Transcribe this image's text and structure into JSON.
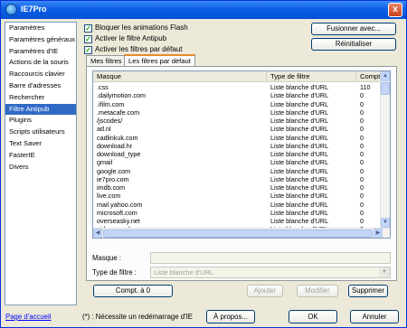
{
  "window": {
    "title": "IE7Pro",
    "close_glyph": "x"
  },
  "sidebar": {
    "items": [
      {
        "label": "Paramètres"
      },
      {
        "label": "Paramètres généraux"
      },
      {
        "label": "Paramètres d'IE"
      },
      {
        "label": "Actions de la souris"
      },
      {
        "label": "Raccourcis clavier"
      },
      {
        "label": "Barre d'adresses"
      },
      {
        "label": "Rechercher"
      },
      {
        "label": "Filtre Antipub",
        "selected": true
      },
      {
        "label": "Plugins"
      },
      {
        "label": "Scripts utilisateurs"
      },
      {
        "label": "Text Saver"
      },
      {
        "label": "FasterIE"
      },
      {
        "label": "Divers"
      }
    ]
  },
  "options": {
    "block_flash": "Bloquer les animations Flash",
    "enable_filter": "Activer le filtre Antipub",
    "enable_default": "Activer les filtres par défaut"
  },
  "buttons": {
    "merge": "Fusionner avec...",
    "reset": "Réinitialiser",
    "reset_count": "Compt. à 0",
    "add": "Ajouter",
    "modify": "Modifier",
    "delete": "Supprimer",
    "about": "À propos...",
    "ok": "OK",
    "cancel": "Annuler"
  },
  "tabs": [
    {
      "label": "Mes filtres"
    },
    {
      "label": "Les filtres par défaut",
      "active": true
    }
  ],
  "table": {
    "columns": [
      "Masque",
      "Type de filtre",
      "Compteu"
    ],
    "rows": [
      [
        ".css",
        "Liste blanche d'URL",
        "110"
      ],
      [
        ".dailymotion.com",
        "Liste blanche d'URL",
        "0"
      ],
      [
        ".ifilm.com",
        "Liste blanche d'URL",
        "0"
      ],
      [
        ".metacafe.com",
        "Liste blanche d'URL",
        "0"
      ],
      [
        "/jscodes/",
        "Liste blanche d'URL",
        "0"
      ],
      [
        "ad.nl",
        "Liste blanche d'URL",
        "0"
      ],
      [
        "cadlinkuk.com",
        "Liste blanche d'URL",
        "0"
      ],
      [
        "download.hr",
        "Liste blanche d'URL",
        "0"
      ],
      [
        "download_type",
        "Liste blanche d'URL",
        "0"
      ],
      [
        "gmail",
        "Liste blanche d'URL",
        "0"
      ],
      [
        "google.com",
        "Liste blanche d'URL",
        "0"
      ],
      [
        "ie7pro.com",
        "Liste blanche d'URL",
        "0"
      ],
      [
        "imdb.com",
        "Liste blanche d'URL",
        "0"
      ],
      [
        "live.com",
        "Liste blanche d'URL",
        "0"
      ],
      [
        "mail.yahoo.com",
        "Liste blanche d'URL",
        "0"
      ],
      [
        "microsoft.com",
        "Liste blanche d'URL",
        "0"
      ],
      [
        "overseasky.net",
        "Liste blanche d'URL",
        "0"
      ],
      [
        "video.google.com",
        "Liste blanche d'URL",
        "0"
      ]
    ]
  },
  "form": {
    "mask_label": "Masque :",
    "mask_value": "",
    "filter_type_label": "Type de filtre :",
    "filter_type_value": "Liste blanche d'URL"
  },
  "footer": {
    "home_link": "Page d'accueil",
    "restart_note": "(*) : Nécessite un redémarrage d'IE"
  }
}
